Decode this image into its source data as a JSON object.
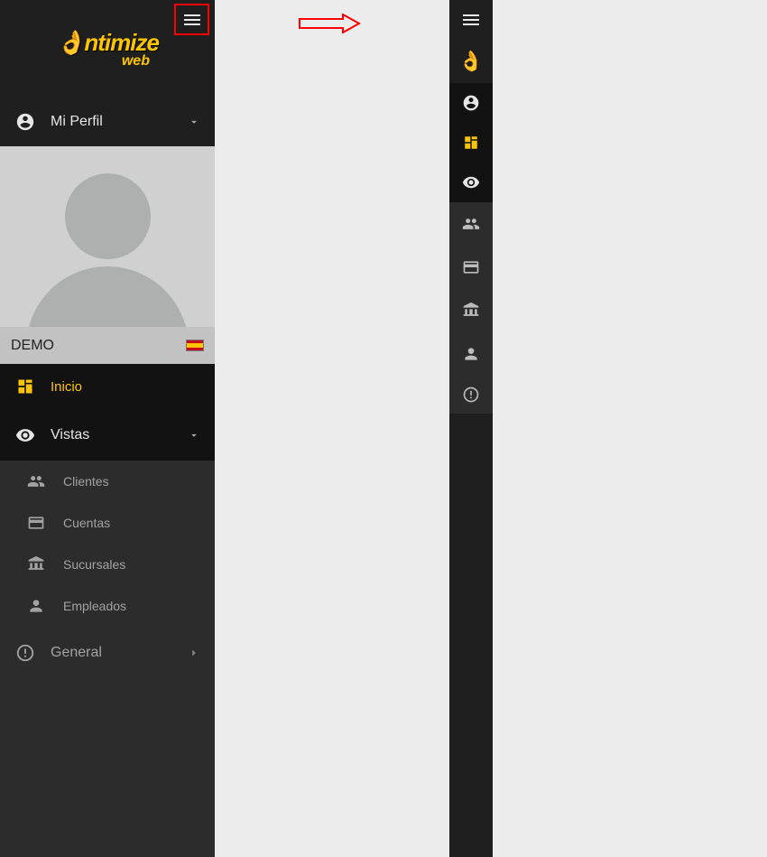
{
  "brand": {
    "name": "ntimize",
    "sub": "web"
  },
  "profile": {
    "section_label": "Mi Perfil",
    "username": "DEMO"
  },
  "nav": {
    "home": "Inicio",
    "views": "Vistas",
    "clients": "Clientes",
    "accounts": "Cuentas",
    "branches": "Sucursales",
    "employees": "Empleados",
    "general": "General"
  },
  "colors": {
    "accent": "#ffc600",
    "highlight_border": "#ff0000"
  }
}
